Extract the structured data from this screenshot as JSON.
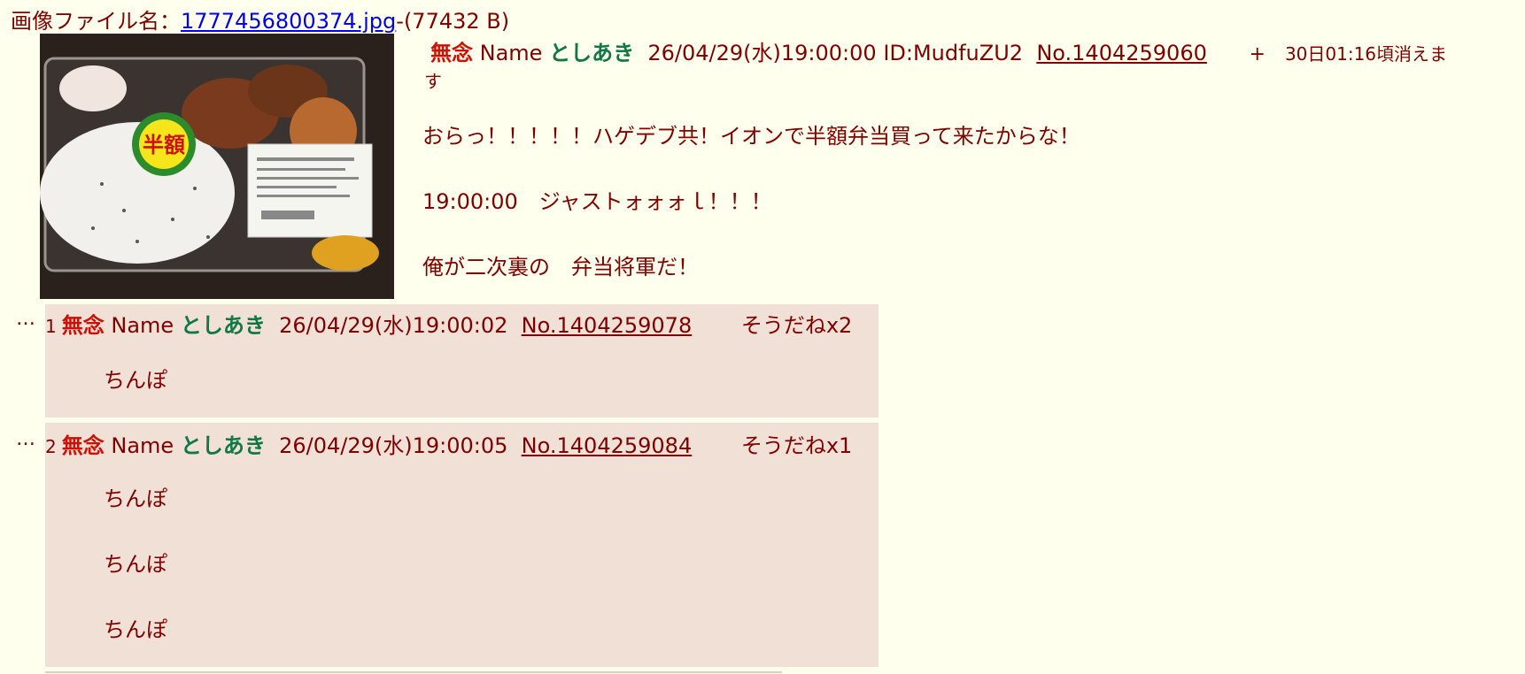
{
  "file": {
    "prefix": "画像ファイル名：",
    "name": "1777456800374.jpg",
    "size": "-(77432 B)"
  },
  "op": {
    "subject": "無念",
    "name_label": "Name",
    "name": "としあき",
    "datetime": "26/04/29(水)19:00:00",
    "id": "ID:MudfuZU2",
    "number": "No.1404259060",
    "plus": "+",
    "expire_main": "30日01:16頃消えま",
    "expire_wrap": "す",
    "lines": [
      "おらっ！！！！！ハゲデブ共！イオンで半額弁当買って来たからな！",
      "19:00:00　ジャストォォォｌ！！！",
      "俺が二次裏の　弁当将軍だ！"
    ]
  },
  "thumb": {
    "icon": "bento-photo"
  },
  "replies": [
    {
      "dots": "…",
      "index": "1",
      "subject": "無念",
      "name_label": "Name",
      "name": "としあき",
      "datetime": "26/04/29(水)19:00:02",
      "number": "No.1404259078",
      "sodane": "そうだねx2",
      "lines": [
        "ちんぽ"
      ]
    },
    {
      "dots": "…",
      "index": "2",
      "subject": "無念",
      "name_label": "Name",
      "name": "としあき",
      "datetime": "26/04/29(水)19:00:05",
      "number": "No.1404259084",
      "sodane": "そうだねx1",
      "lines": [
        "ちんぽ",
        "ちんぽ",
        "ちんぽ"
      ]
    }
  ],
  "colors": {
    "background": "#ffffee",
    "text": "#800000",
    "subject": "#cc1105",
    "name": "#117743",
    "reply_bg": "#f0e0d6",
    "link": "#0000ee"
  }
}
